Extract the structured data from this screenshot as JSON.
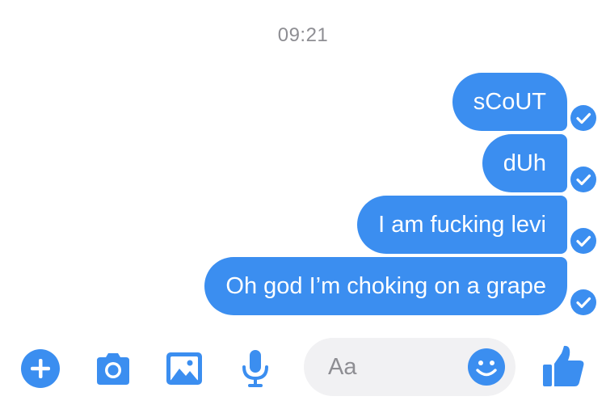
{
  "timestamp": "09:21",
  "colors": {
    "accent": "#3b8ef0",
    "bubble_text": "#ffffff",
    "timestamp": "#8e8e93",
    "compose_background": "#f1f1f3"
  },
  "messages": [
    {
      "text": "sCoUT",
      "status": "sent-check-icon"
    },
    {
      "text": "dUh",
      "status": "sent-check-icon"
    },
    {
      "text": "I am fucking levi",
      "status": "sent-check-icon"
    },
    {
      "text": "Oh god I’m choking on a grape",
      "status": "sent-check-icon"
    }
  ],
  "toolbar": {
    "icons": [
      "plus-icon",
      "camera-icon",
      "image-icon",
      "microphone-icon"
    ],
    "compose_placeholder": "Aa",
    "compose_value": "",
    "emoji_icon": "smiley-icon",
    "send_icon": "thumbs-up-icon"
  }
}
